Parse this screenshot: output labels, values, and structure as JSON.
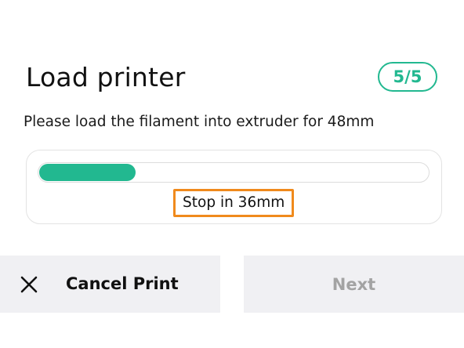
{
  "header": {
    "title": "Load printer",
    "step_badge": "5/5"
  },
  "instruction": "Please load the filament into extruder for 48mm",
  "progress": {
    "fraction": 0.25,
    "remaining_label": "Stop in 36mm",
    "fill_color": "#22b890"
  },
  "buttons": {
    "cancel_label": "Cancel Print",
    "cancel_icon": "close-icon",
    "next_label": "Next",
    "next_enabled": false
  },
  "colors": {
    "accent": "#22b890",
    "highlight": "#f08a1c",
    "button_bg": "#f0f0f3",
    "disabled_text": "#a3a3a3"
  }
}
